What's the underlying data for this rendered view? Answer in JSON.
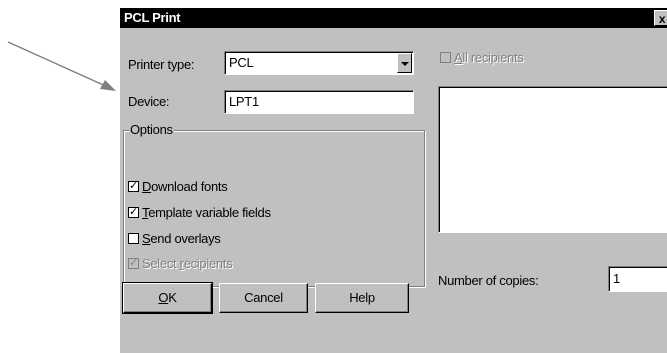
{
  "dialog": {
    "title": "PCL Print",
    "close_glyph": "x"
  },
  "printer_type": {
    "label": "Printer type:",
    "value": "PCL"
  },
  "device": {
    "label": "Device:",
    "value": "LPT1"
  },
  "options": {
    "title": "Options",
    "download_fonts": {
      "pre": "",
      "accel": "D",
      "post": "ownload fonts",
      "checked": true
    },
    "template_fields": {
      "pre": "",
      "accel": "T",
      "post": "emplate variable fields",
      "checked": true
    },
    "send_overlays": {
      "pre": "",
      "accel": "S",
      "post": "end overlays",
      "checked": false
    },
    "select_recipients": {
      "pre": "Select ",
      "accel": "r",
      "post": "ecipients",
      "checked": true,
      "disabled": true
    }
  },
  "all_recipients": {
    "pre": "",
    "accel": "A",
    "post": "ll recipients",
    "checked": false,
    "disabled": true
  },
  "copies": {
    "label": "Number of copies:",
    "value": "1"
  },
  "buttons": {
    "ok": {
      "accel": "O",
      "post": "K"
    },
    "cancel": "Cancel",
    "help": "Help"
  },
  "check_glyph": "✓"
}
